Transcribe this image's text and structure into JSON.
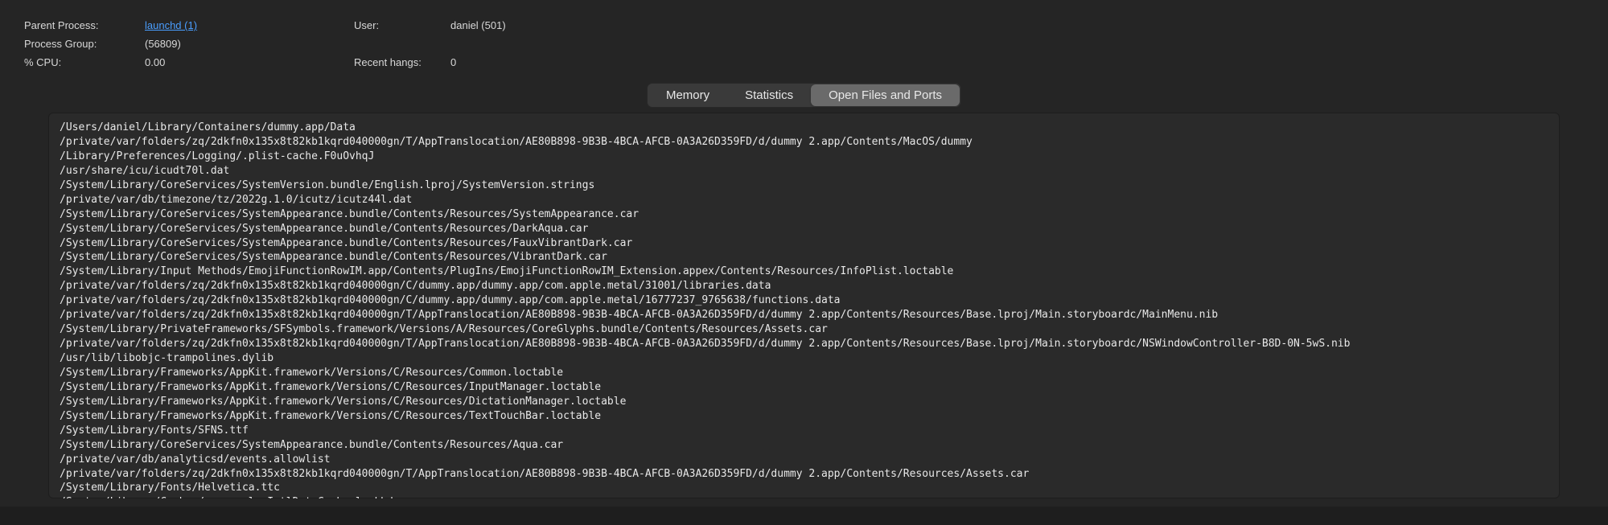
{
  "info": {
    "parent_process_label": "Parent Process:",
    "parent_process_link": "launchd (1)",
    "user_label": "User:",
    "user_value": "daniel (501)",
    "process_group_label": "Process Group:",
    "process_group_value": " (56809)",
    "cpu_label": "% CPU:",
    "cpu_value": "0.00",
    "recent_hangs_label": "Recent hangs:",
    "recent_hangs_value": "0"
  },
  "tabs": {
    "memory": "Memory",
    "statistics": "Statistics",
    "open_files": "Open Files and Ports"
  },
  "files": [
    "/Users/daniel/Library/Containers/dummy.app/Data",
    "/private/var/folders/zq/2dkfn0x135x8t82kb1kqrd040000gn/T/AppTranslocation/AE80B898-9B3B-4BCA-AFCB-0A3A26D359FD/d/dummy 2.app/Contents/MacOS/dummy",
    "/Library/Preferences/Logging/.plist-cache.F0uOvhqJ",
    "/usr/share/icu/icudt70l.dat",
    "/System/Library/CoreServices/SystemVersion.bundle/English.lproj/SystemVersion.strings",
    "/private/var/db/timezone/tz/2022g.1.0/icutz/icutz44l.dat",
    "/System/Library/CoreServices/SystemAppearance.bundle/Contents/Resources/SystemAppearance.car",
    "/System/Library/CoreServices/SystemAppearance.bundle/Contents/Resources/DarkAqua.car",
    "/System/Library/CoreServices/SystemAppearance.bundle/Contents/Resources/FauxVibrantDark.car",
    "/System/Library/CoreServices/SystemAppearance.bundle/Contents/Resources/VibrantDark.car",
    "/System/Library/Input Methods/EmojiFunctionRowIM.app/Contents/PlugIns/EmojiFunctionRowIM_Extension.appex/Contents/Resources/InfoPlist.loctable",
    "/private/var/folders/zq/2dkfn0x135x8t82kb1kqrd040000gn/C/dummy.app/dummy.app/com.apple.metal/31001/libraries.data",
    "/private/var/folders/zq/2dkfn0x135x8t82kb1kqrd040000gn/C/dummy.app/dummy.app/com.apple.metal/16777237_9765638/functions.data",
    "/private/var/folders/zq/2dkfn0x135x8t82kb1kqrd040000gn/T/AppTranslocation/AE80B898-9B3B-4BCA-AFCB-0A3A26D359FD/d/dummy 2.app/Contents/Resources/Base.lproj/Main.storyboardc/MainMenu.nib",
    "/System/Library/PrivateFrameworks/SFSymbols.framework/Versions/A/Resources/CoreGlyphs.bundle/Contents/Resources/Assets.car",
    "/private/var/folders/zq/2dkfn0x135x8t82kb1kqrd040000gn/T/AppTranslocation/AE80B898-9B3B-4BCA-AFCB-0A3A26D359FD/d/dummy 2.app/Contents/Resources/Base.lproj/Main.storyboardc/NSWindowController-B8D-0N-5wS.nib",
    "/usr/lib/libobjc-trampolines.dylib",
    "/System/Library/Frameworks/AppKit.framework/Versions/C/Resources/Common.loctable",
    "/System/Library/Frameworks/AppKit.framework/Versions/C/Resources/InputManager.loctable",
    "/System/Library/Frameworks/AppKit.framework/Versions/C/Resources/DictationManager.loctable",
    "/System/Library/Frameworks/AppKit.framework/Versions/C/Resources/TextTouchBar.loctable",
    "/System/Library/Fonts/SFNS.ttf",
    "/System/Library/CoreServices/SystemAppearance.bundle/Contents/Resources/Aqua.car",
    "/private/var/db/analyticsd/events.allowlist",
    "/private/var/folders/zq/2dkfn0x135x8t82kb1kqrd040000gn/T/AppTranslocation/AE80B898-9B3B-4BCA-AFCB-0A3A26D359FD/d/dummy 2.app/Contents/Resources/Assets.car",
    "/System/Library/Fonts/Helvetica.ttc",
    "/System/Library/Caches/com.apple.IntlDataCache.le.kbdx"
  ]
}
